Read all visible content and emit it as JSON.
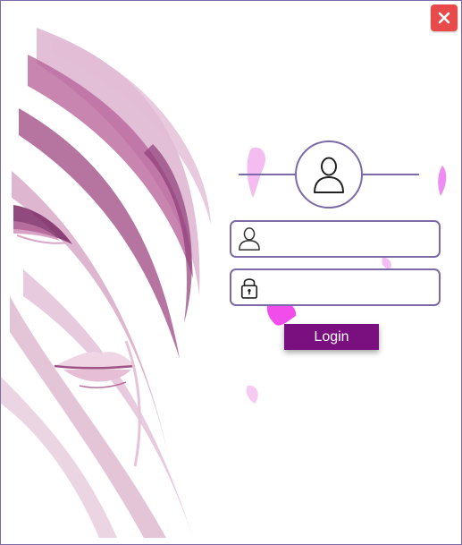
{
  "window": {
    "title": "",
    "colors": {
      "border": "#7b6aa6",
      "accent": "#7a0f80",
      "close": "#e84a4a",
      "splash": "#e040e8"
    }
  },
  "close_button": {
    "icon": "close-icon"
  },
  "avatar": {
    "icon": "user-icon"
  },
  "username": {
    "icon": "user-icon",
    "value": "",
    "placeholder": ""
  },
  "password": {
    "icon": "lock-icon",
    "value": "",
    "placeholder": ""
  },
  "login_button": {
    "label": "Login"
  }
}
